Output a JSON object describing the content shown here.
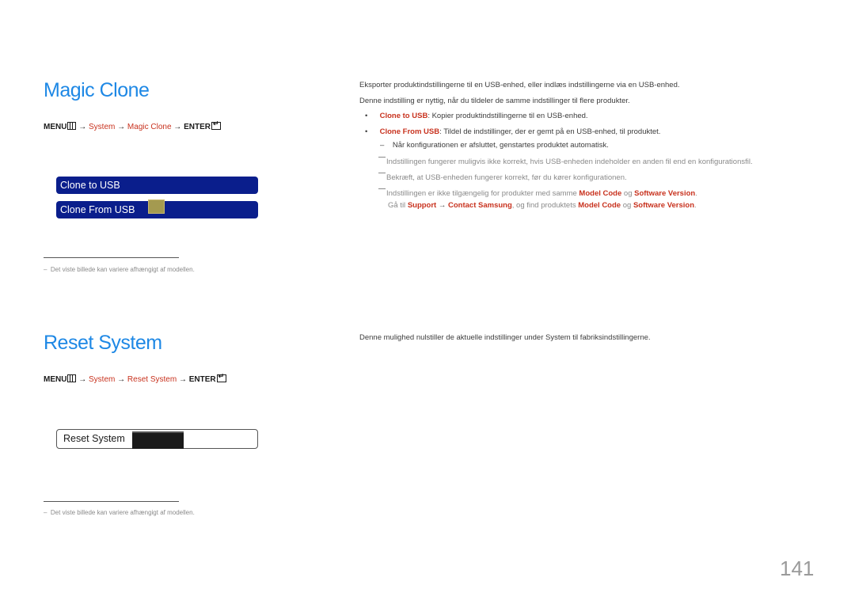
{
  "magic_clone": {
    "title": "Magic Clone",
    "path": {
      "menu": "MENU",
      "arrow": "→",
      "system": "System",
      "item": "Magic Clone",
      "enter": "ENTER",
      "menu_icon": "menu-icon",
      "enter_icon": "enter-icon"
    },
    "menu_items": [
      {
        "label": "Clone to USB"
      },
      {
        "label": "Clone From USB"
      }
    ],
    "footnote": "Det viste billede kan variere afhængigt af modellen.",
    "footnote_dash": "–",
    "description": [
      "Eksporter produktindstillingerne til en USB-enhed, eller indlæs indstillingerne via en USB-enhed.",
      "Denne indstilling er nyttig, når du tildeler de samme indstillinger til flere produkter."
    ],
    "bullets": [
      {
        "bold": "Clone to USB",
        "text": ": Kopier produktindstillingerne til en USB-enhed."
      },
      {
        "bold": "Clone From USB",
        "text": ": Tildel de indstillinger, der er gemt på en USB-enhed, til produktet."
      }
    ],
    "bullet_char": "•",
    "sub_note": "Når konfigurationen er afsluttet, genstartes produktet automatisk.",
    "sub_dash": "–",
    "notes": [
      "Indstillingen fungerer muligvis ikke korrekt, hvis USB-enheden indeholder en anden fil end en konfigurationsfil.",
      "Bekræft, at USB-enheden fungerer korrekt, før du kører konfigurationen."
    ],
    "note3": {
      "t1": "Indstillingen er ikke tilgængelig for produkter med samme ",
      "b1": "Model Code",
      "t2": " og ",
      "b2": "Software Version",
      "t3": ".",
      "l2_t1": "Gå til ",
      "l2_b1": "Support",
      "l2_arrow": " → ",
      "l2_b2": "Contact Samsung",
      "l2_t2": ", og find produktets ",
      "l2_b3": "Model Code",
      "l2_t3": " og ",
      "l2_b4": "Software Version",
      "l2_t4": "."
    }
  },
  "reset_system": {
    "title": "Reset System",
    "path": {
      "menu": "MENU",
      "arrow": "→",
      "system": "System",
      "item": "Reset System",
      "enter": "ENTER"
    },
    "box_label": "Reset System",
    "footnote": "Det viste billede kan variere afhængigt af modellen.",
    "footnote_dash": "–",
    "description": "Denne mulighed nulstiller de aktuelle indstillinger under System til fabriksindstillingerne."
  },
  "page_number": "141",
  "colors": {
    "title_blue": "#1e88e5",
    "accent_red": "#c8321e",
    "menu_navy": "#0a1e8c"
  }
}
